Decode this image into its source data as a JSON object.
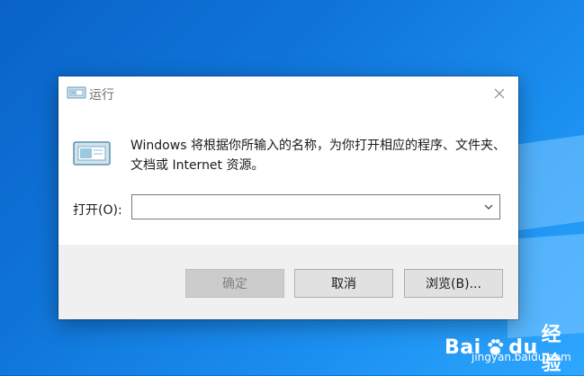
{
  "window": {
    "title": "运行"
  },
  "dialog": {
    "description": "Windows 将根据你所输入的名称，为你打开相应的程序、文件夹、文档或 Internet 资源。",
    "open_label": "打开(O):",
    "open_value": "",
    "buttons": {
      "ok": "确定",
      "cancel": "取消",
      "browse": "浏览(B)..."
    }
  },
  "watermark": {
    "brand": "Bai",
    "brand_suffix": "du",
    "brand_cn": "经验",
    "url": "jingyan.baidu.com"
  },
  "icons": {
    "title": "run-icon",
    "main": "run-icon",
    "close": "close-icon",
    "dropdown": "chevron-down-icon",
    "watermark": "baidu-paw-icon"
  },
  "colors": {
    "desktop": "#0f74d8",
    "dialog_bg": "#ffffff",
    "footer_bg": "#f0f0f0",
    "button_bg": "#e1e1e1",
    "disabled_text": "#838383"
  }
}
